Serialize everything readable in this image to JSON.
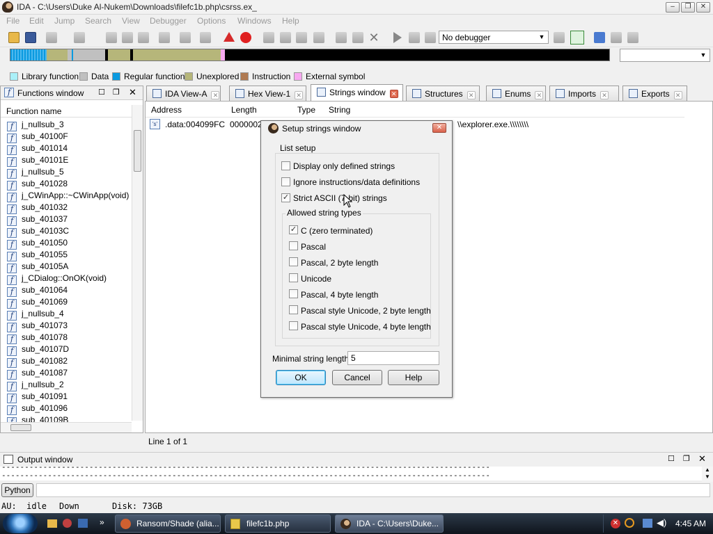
{
  "window": {
    "title": "IDA - C:\\Users\\Duke Al-Nukem\\Downloads\\filefc1b.php\\csrss.ex_"
  },
  "menu": [
    "File",
    "Edit",
    "Jump",
    "Search",
    "View",
    "Debugger",
    "Options",
    "Windows",
    "Help"
  ],
  "toolbar": {
    "debugger_select": "No debugger"
  },
  "legend": [
    {
      "label": "Library function",
      "color": "#aaf0f8"
    },
    {
      "label": "Data",
      "color": "#c0c0c0"
    },
    {
      "label": "Regular function",
      "color": "#0a9ae0"
    },
    {
      "label": "Unexplored",
      "color": "#b6b67a"
    },
    {
      "label": "Instruction",
      "color": "#b07a52"
    },
    {
      "label": "External symbol",
      "color": "#f7a8f0"
    }
  ],
  "functions": {
    "title": "Functions window",
    "column": "Function name",
    "items": [
      "j_nullsub_3",
      "sub_40100F",
      "sub_401014",
      "sub_40101E",
      "j_nullsub_5",
      "sub_401028",
      "j_CWinApp::~CWinApp(void)",
      "sub_401032",
      "sub_401037",
      "sub_40103C",
      "sub_401050",
      "sub_401055",
      "sub_40105A",
      "j_CDialog::OnOK(void)",
      "sub_401064",
      "sub_401069",
      "j_nullsub_4",
      "sub_401073",
      "sub_401078",
      "sub_40107D",
      "sub_401082",
      "sub_401087",
      "j_nullsub_2",
      "sub_401091",
      "sub_401096",
      "sub_40109B"
    ]
  },
  "tabs": [
    "IDA View-A",
    "Hex View-1",
    "Strings window",
    "Structures",
    "Enums",
    "Imports",
    "Exports"
  ],
  "strings": {
    "columns": [
      "Address",
      "Length",
      "Type",
      "String"
    ],
    "row": {
      "address": ".data:004099FC",
      "length": "0000002",
      "string": "\\\\explorer.exe.\\\\\\\\\\\\\\\\"
    },
    "status": "Line 1 of 1"
  },
  "dialog": {
    "title": "Setup strings window",
    "group_list": "List setup",
    "options": [
      {
        "label": "Display only defined strings",
        "checked": false
      },
      {
        "label": "Ignore instructions/data definitions",
        "checked": false
      },
      {
        "label": "Strict ASCII (7-bit) strings",
        "checked": true
      }
    ],
    "group_types": "Allowed string types",
    "types": [
      {
        "label": "C (zero terminated)",
        "checked": true
      },
      {
        "label": "Pascal",
        "checked": false
      },
      {
        "label": "Pascal, 2 byte length",
        "checked": false
      },
      {
        "label": "Unicode",
        "checked": false
      },
      {
        "label": "Pascal, 4 byte length",
        "checked": false
      },
      {
        "label": "Pascal style Unicode, 2 byte length",
        "checked": false
      },
      {
        "label": "Pascal style Unicode, 4 byte length",
        "checked": false
      }
    ],
    "min_length_label": "Minimal string length:",
    "min_length_value": "5",
    "buttons": {
      "ok": "OK",
      "cancel": "Cancel",
      "help": "Help"
    }
  },
  "output": {
    "title": "Output window",
    "line": "----------------------------------------------------------------------------------------------------------",
    "python_btn": "Python"
  },
  "statusbar": {
    "au": "AU:  idle",
    "state": "Down",
    "disk": "Disk: 73GB"
  },
  "taskbar": {
    "tasks": [
      "Ransom/Shade (alia...",
      "filefc1b.php",
      "IDA - C:\\Users\\Duke..."
    ],
    "clock": "4:45 AM"
  }
}
